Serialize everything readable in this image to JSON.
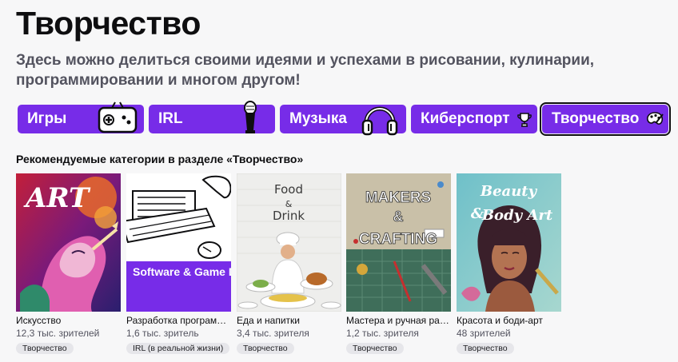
{
  "header": {
    "title": "Творчество",
    "description": "Здесь можно делиться своими идеями и успехами в рисовании, кулинарии, программировании и многом другом!"
  },
  "tabs": [
    {
      "label": "Игры",
      "icon": "gamepad-icon",
      "active": false
    },
    {
      "label": "IRL",
      "icon": "microphone-icon",
      "active": false
    },
    {
      "label": "Музыка",
      "icon": "headphones-icon",
      "active": false
    },
    {
      "label": "Киберспорт",
      "icon": "trophy-icon",
      "active": false
    },
    {
      "label": "Творчество",
      "icon": "palette-icon",
      "active": true
    }
  ],
  "section": {
    "title": "Рекомендуемые категории в разделе «Творчество»"
  },
  "cards": [
    {
      "name": "Искусство",
      "viewers": "12,3 тыс. зрителей",
      "tag": "Творчество",
      "art_text": "ART"
    },
    {
      "name": "Разработка программ…",
      "viewers": "1,6 тыс. зритель",
      "tag": "IRL (в реальной жизни)",
      "art_text": "Software & Game Development"
    },
    {
      "name": "Еда и напитки",
      "viewers": "3,4 тыс. зрителя",
      "tag": "Творчество",
      "art_text_1": "Food",
      "art_text_2": "&",
      "art_text_3": "Drink"
    },
    {
      "name": "Мастера и ручная раб…",
      "viewers": "1,2 тыс. зрителя",
      "tag": "Творчество",
      "art_text_1": "MAKERS",
      "art_text_2": "&",
      "art_text_3": "CRAFTING"
    },
    {
      "name": "Красота и боди-арт",
      "viewers": "48 зрителей",
      "tag": "Творчество",
      "art_text_1": "Beauty",
      "art_text_2": "&",
      "art_text_3": "Body Art"
    }
  ],
  "colors": {
    "accent": "#772ce8",
    "background": "#f7f7f8",
    "text": "#0e0e10",
    "muted": "#53535f"
  }
}
